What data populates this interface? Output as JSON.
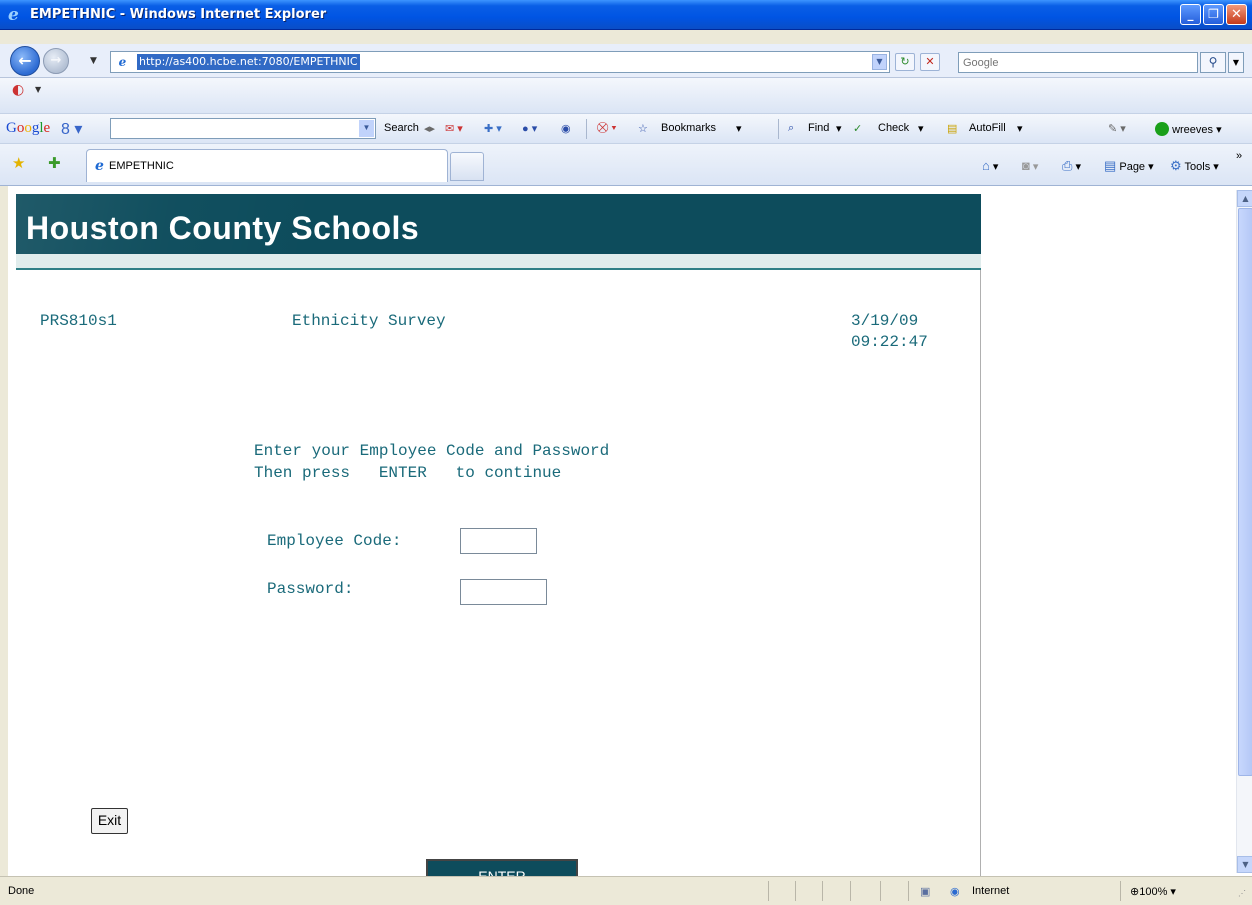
{
  "window": {
    "title": "EMPETHNIC - Windows Internet Explorer"
  },
  "address": {
    "url": "http://as400.hcbe.net:7080/EMPETHNIC",
    "search_placeholder": "Google"
  },
  "google_toolbar": {
    "logo": "Google",
    "search_label": "Search",
    "bookmarks": "Bookmarks",
    "find": "Find",
    "check": "Check",
    "autofill": "AutoFill",
    "user": "wreeves"
  },
  "tabs": {
    "active": "EMPETHNIC"
  },
  "command_bar": {
    "page": "Page",
    "tools": "Tools"
  },
  "page": {
    "banner_title": "Houston County Schools",
    "program_id": "PRS810s1",
    "screen_title": "Ethnicity Survey",
    "date": "3/19/09",
    "time": "09:22:47",
    "instruction_line1": "Enter your Employee Code and Password",
    "instruction_line2": "Then press   ENTER   to continue",
    "employee_code_label": "Employee Code:",
    "password_label": "Password:",
    "exit_button": "Exit",
    "enter_button": "ENTER"
  },
  "status": {
    "text": "Done",
    "zone": "Internet",
    "zoom": "100%"
  }
}
